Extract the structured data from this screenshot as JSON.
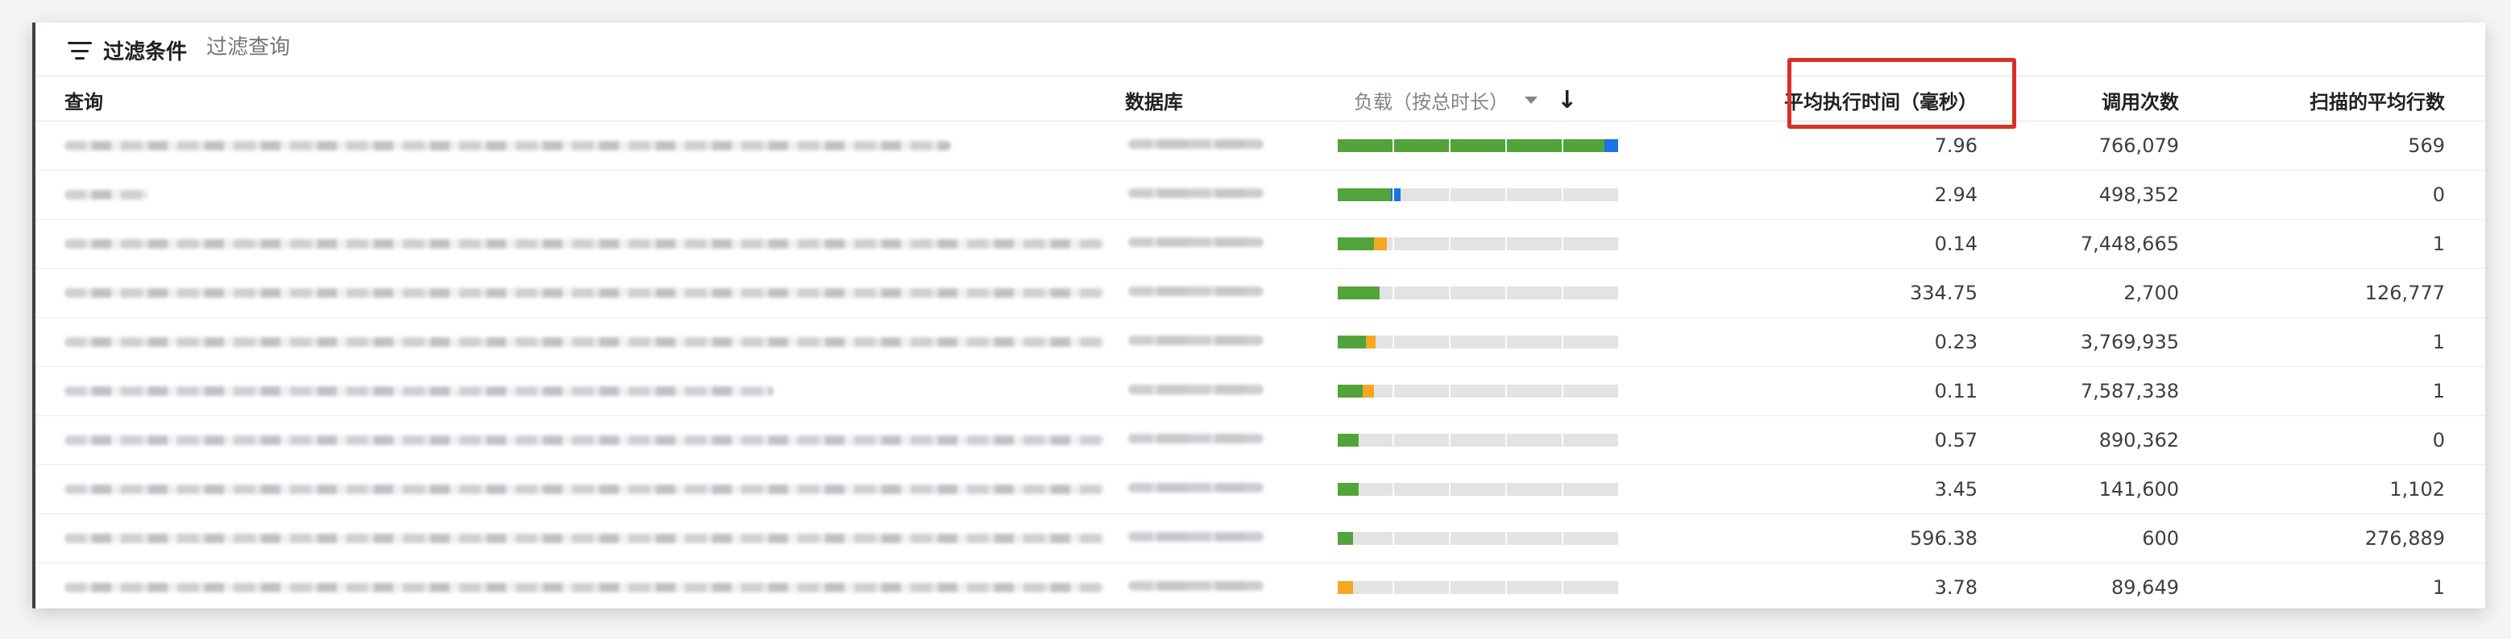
{
  "filter": {
    "icon": "filter-list-icon",
    "title": "过滤条件",
    "placeholder": "过滤查询"
  },
  "columns": {
    "query": "查询",
    "database": "数据库",
    "load": "负载（按总时长）",
    "avg_exec_time": "平均执行时间（毫秒）",
    "calls": "调用次数",
    "avg_rows_scanned": "扫描的平均行数"
  },
  "sort": {
    "icon": "arrow-down-icon",
    "dropdown_icon": "caret-down-icon"
  },
  "colors": {
    "green": "#52a33a",
    "blue": "#1a73e8",
    "orange": "#f5a623",
    "track": "#e3e3e3",
    "highlight": "#d93025"
  },
  "rows": [
    {
      "avg": "7.96",
      "calls": "766,079",
      "rows_scanned": "569",
      "load": [
        {
          "color": "#52a33a",
          "fraction": 0.95
        },
        {
          "color": "#1a73e8",
          "fraction": 0.05
        }
      ]
    },
    {
      "avg": "2.94",
      "calls": "498,352",
      "rows_scanned": "0",
      "load": [
        {
          "color": "#52a33a",
          "fraction": 0.19
        },
        {
          "color": "#1a73e8",
          "fraction": 0.035
        }
      ]
    },
    {
      "avg": "0.14",
      "calls": "7,448,665",
      "rows_scanned": "1",
      "load": [
        {
          "color": "#52a33a",
          "fraction": 0.13
        },
        {
          "color": "#f5a623",
          "fraction": 0.045
        }
      ]
    },
    {
      "avg": "334.75",
      "calls": "2,700",
      "rows_scanned": "126,777",
      "load": [
        {
          "color": "#52a33a",
          "fraction": 0.15
        }
      ]
    },
    {
      "avg": "0.23",
      "calls": "3,769,935",
      "rows_scanned": "1",
      "load": [
        {
          "color": "#52a33a",
          "fraction": 0.1
        },
        {
          "color": "#f5a623",
          "fraction": 0.035
        }
      ]
    },
    {
      "avg": "0.11",
      "calls": "7,587,338",
      "rows_scanned": "1",
      "load": [
        {
          "color": "#52a33a",
          "fraction": 0.09
        },
        {
          "color": "#f5a623",
          "fraction": 0.04
        }
      ]
    },
    {
      "avg": "0.57",
      "calls": "890,362",
      "rows_scanned": "0",
      "load": [
        {
          "color": "#52a33a",
          "fraction": 0.075
        }
      ]
    },
    {
      "avg": "3.45",
      "calls": "141,600",
      "rows_scanned": "1,102",
      "load": [
        {
          "color": "#52a33a",
          "fraction": 0.075
        }
      ]
    },
    {
      "avg": "596.38",
      "calls": "600",
      "rows_scanned": "276,889",
      "load": [
        {
          "color": "#52a33a",
          "fraction": 0.055
        }
      ]
    },
    {
      "avg": "3.78",
      "calls": "89,649",
      "rows_scanned": "1",
      "load": [
        {
          "color": "#f5a623",
          "fraction": 0.055
        }
      ]
    }
  ]
}
